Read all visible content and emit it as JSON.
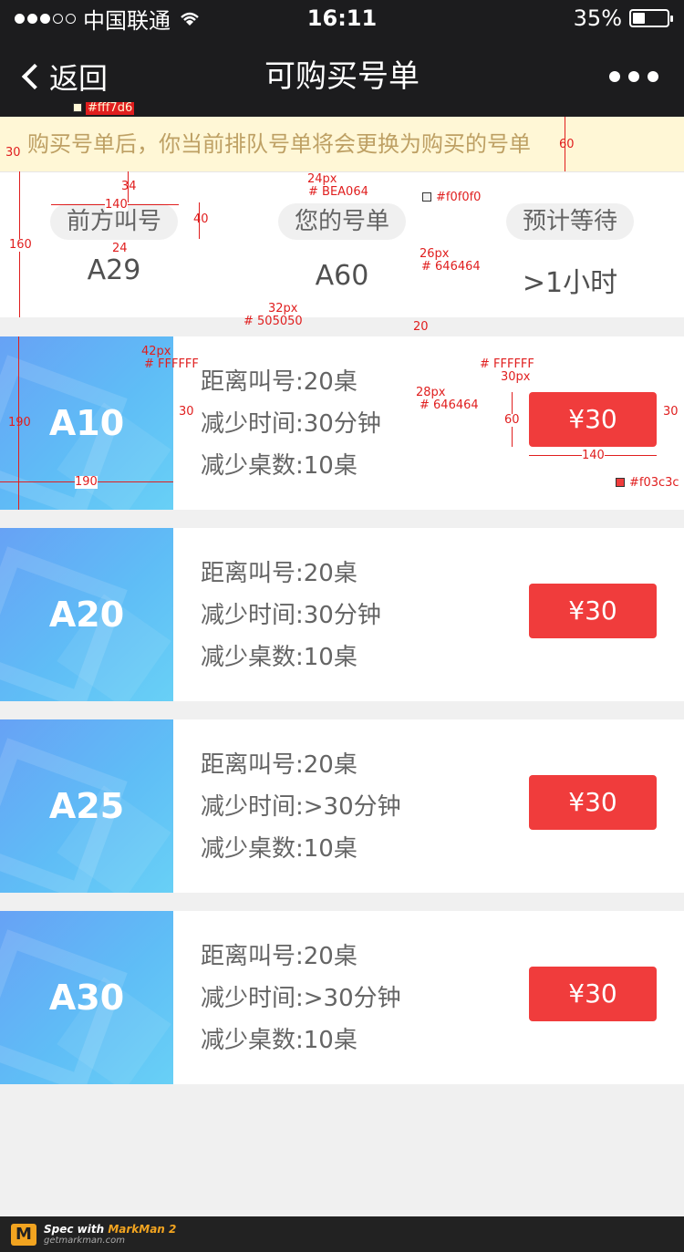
{
  "status_bar": {
    "carrier": "中国联通",
    "time": "16:11",
    "battery": "35%",
    "battery_level": 0.35
  },
  "nav": {
    "back_label": "返回",
    "title": "可购买号单"
  },
  "notice": {
    "text": "购买号单后，你当前排队号单将会更换为购买的号单"
  },
  "info": [
    {
      "label": "前方叫号",
      "value": "A29"
    },
    {
      "label": "您的号单",
      "value": "A60"
    },
    {
      "label": "预计等待",
      "value": ">1小时"
    }
  ],
  "cards": [
    {
      "number": "A10",
      "lines": [
        "距离叫号:20桌",
        "减少时间:30分钟",
        "减少桌数:10桌"
      ],
      "price": "¥30"
    },
    {
      "number": "A20",
      "lines": [
        "距离叫号:20桌",
        "减少时间:30分钟",
        "减少桌数:10桌"
      ],
      "price": "¥30"
    },
    {
      "number": "A25",
      "lines": [
        "距离叫号:20桌",
        "减少时间:>30分钟",
        "减少桌数:10桌"
      ],
      "price": "¥30"
    },
    {
      "number": "A30",
      "lines": [
        "距离叫号:20桌",
        "减少时间:>30分钟",
        "减少桌数:10桌"
      ],
      "price": "¥30"
    }
  ],
  "annotations": {
    "notice_bg": "#fff7d6",
    "notice_h": "60",
    "left_pad": "30",
    "notice_font": "24px",
    "notice_color": "# BEA064",
    "pill_top": "34",
    "pill_w": "140",
    "pill_h": "40",
    "val_gap": "24",
    "info_h": "160",
    "pill_bg": "#f0f0f0",
    "pill_font": "26px",
    "pill_color": "# 646464",
    "val_font": "32px",
    "val_color": "# 505050",
    "section_gap": "20",
    "num_font": "42px",
    "num_color": "# FFFFFF",
    "card_h": "190",
    "card_w": "190",
    "line_gap": "30",
    "lines_font": "28px",
    "lines_color": "# 646464",
    "btn_text_color": "# FFFFFF",
    "btn_font": "30px",
    "btn_h": "60",
    "btn_right": "30",
    "btn_w": "140",
    "btn_bg": "#f03c3c"
  },
  "footer": {
    "spec_with": "Spec with ",
    "brand": "MarkMan 2",
    "url": "getmarkman.com"
  },
  "colors": {
    "bar": "#1c1c1e",
    "accent": "#f03c3c",
    "notice_text": "#BEA064",
    "notice_bg": "#fff7d6"
  }
}
